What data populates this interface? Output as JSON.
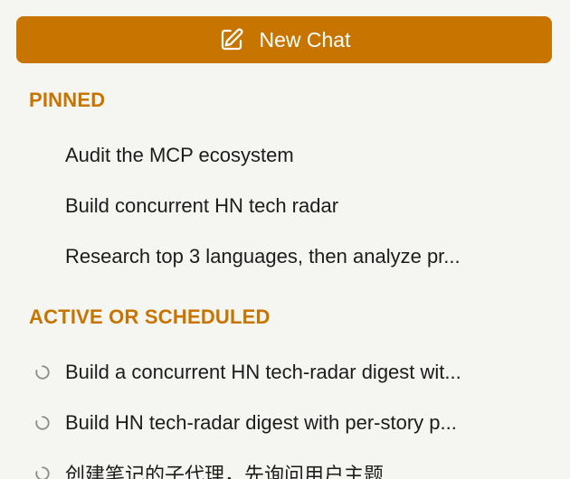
{
  "new_chat": {
    "label": "New Chat",
    "icon": "edit-icon"
  },
  "pinned": {
    "title": "PINNED",
    "items": [
      {
        "label": "Audit the MCP ecosystem"
      },
      {
        "label": "Build concurrent HN tech radar"
      },
      {
        "label": "Research top 3 languages, then analyze pr..."
      }
    ]
  },
  "active": {
    "title": "ACTIVE OR SCHEDULED",
    "items": [
      {
        "label": "Build a concurrent HN tech-radar digest wit...",
        "icon": "spinner-icon"
      },
      {
        "label": "Build HN tech-radar digest with per-story p...",
        "icon": "spinner-icon"
      },
      {
        "label": "创建笔记的子代理，先询问用户主题",
        "icon": "spinner-icon"
      }
    ]
  },
  "colors": {
    "accent": "#c87400",
    "background": "#f5f5f2",
    "text": "#1c1c1c"
  }
}
